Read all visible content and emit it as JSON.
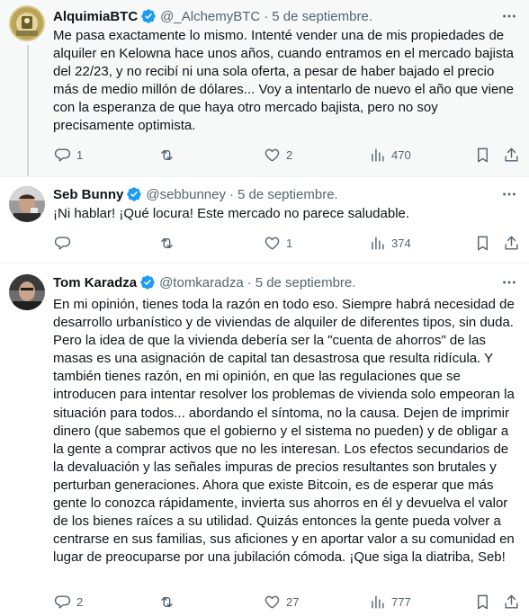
{
  "tweets": [
    {
      "name": "AlquimiaBTC",
      "handle": "@_AlchemyBTC",
      "separator": "·",
      "date": "5 de septiembre.",
      "text": "Me pasa exactamente lo mismo. Intenté vender una de mis propiedades de alquiler en Kelowna hace unos años, cuando entramos en el mercado bajista del 22/23, y no recibí ni una sola oferta, a pesar de haber bajado el precio más de medio millón de dólares... Voy a intentarlo de nuevo el año que viene con la esperanza de que haya otro mercado bajista, pero no soy precisamente optimista.",
      "replies": "1",
      "retweets": "",
      "likes": "2",
      "views": "470"
    },
    {
      "name": "Seb Bunny",
      "handle": "@sebbunney",
      "separator": "·",
      "date": "5 de septiembre.",
      "text": "¡Ni hablar! ¡Qué locura! Este mercado no parece saludable.",
      "replies": "",
      "retweets": "",
      "likes": "1",
      "views": "374"
    },
    {
      "name": "Tom Karadza",
      "handle": "@tomkaradza",
      "separator": "·",
      "date": "5 de septiembre.",
      "text": "En mi opinión, tienes toda la razón en todo eso. Siempre habrá necesidad de desarrollo urbanístico y de viviendas de alquiler de diferentes tipos, sin duda. Pero la idea de que la vivienda debería ser la \"cuenta de ahorros\" de las masas es una asignación de capital tan desastrosa que resulta ridícula. Y también tienes razón, en mi opinión, en que las regulaciones que se introducen para intentar resolver los problemas de vivienda solo empeoran la situación para todos... abordando el síntoma, no la causa. Dejen de imprimir dinero (que sabemos que el gobierno y el sistema no pueden) y de obligar a la gente a comprar activos que no les interesan. Los efectos secundarios de la devaluación y las señales impuras de precios resultantes son brutales y perturban generaciones. Ahora que existe Bitcoin, es de esperar que más gente lo conozca rápidamente, invierta sus ahorros en él y devuelva el valor de los bienes raíces a su utilidad. Quizás entonces la gente pueda volver a centrarse en sus familias, sus aficiones y en aportar valor a su comunidad en lugar de preocuparse por una jubilación cómoda. ¡Que siga la diatriba, Seb!",
      "replies": "2",
      "retweets": "",
      "likes": "27",
      "views": "777"
    }
  ],
  "icons": {
    "reply": "reply-icon",
    "retweet": "retweet-icon",
    "like": "heart-icon",
    "views": "views-icon",
    "bookmark": "bookmark-icon",
    "share": "share-icon",
    "more": "more-icon",
    "verified": "verified-badge-icon"
  },
  "colors": {
    "verified": "#1d9bf0",
    "secondary_text": "#536471",
    "highlight_bg": "#f7f9f9",
    "thread_line": "#cfd9de"
  }
}
